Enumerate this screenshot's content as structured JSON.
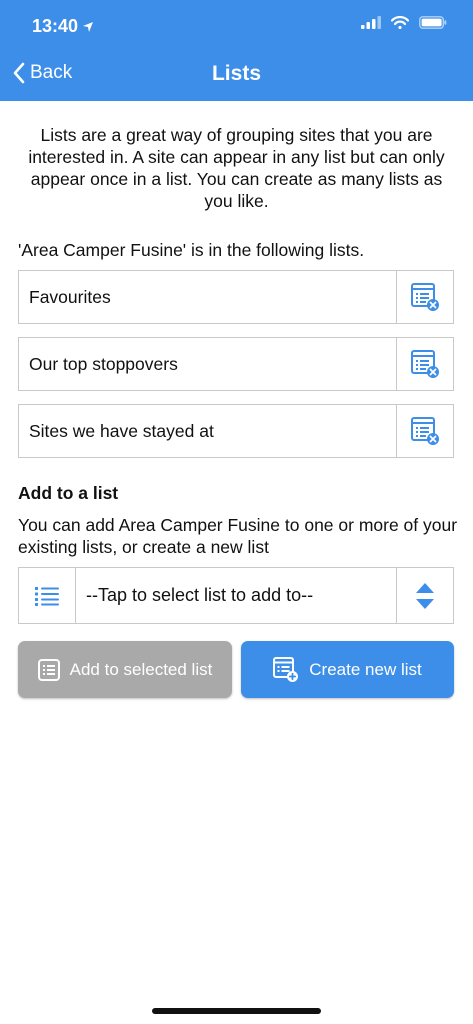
{
  "status": {
    "time": "13:40"
  },
  "header": {
    "back_label": "Back",
    "title": "Lists"
  },
  "intro_text": "Lists are a great way of grouping sites that you are interested in. A site can appear in any list but can only appear once in a list. You can create as many lists as you like.",
  "in_lists_text": "'Area Camper Fusine' is in the following lists.",
  "lists": [
    {
      "label": "Favourites"
    },
    {
      "label": "Our top stoppovers"
    },
    {
      "label": "Sites we have stayed at"
    }
  ],
  "add_section": {
    "heading": "Add to a list",
    "description": "You can add Area Camper Fusine to one or more of your existing lists, or create a new list",
    "select_value": "--Tap to select list to add to--"
  },
  "buttons": {
    "add_selected": "Add to selected list",
    "create_new": "Create new list"
  },
  "colors": {
    "accent": "#3d8ee8",
    "disabled": "#a9a9a9"
  }
}
